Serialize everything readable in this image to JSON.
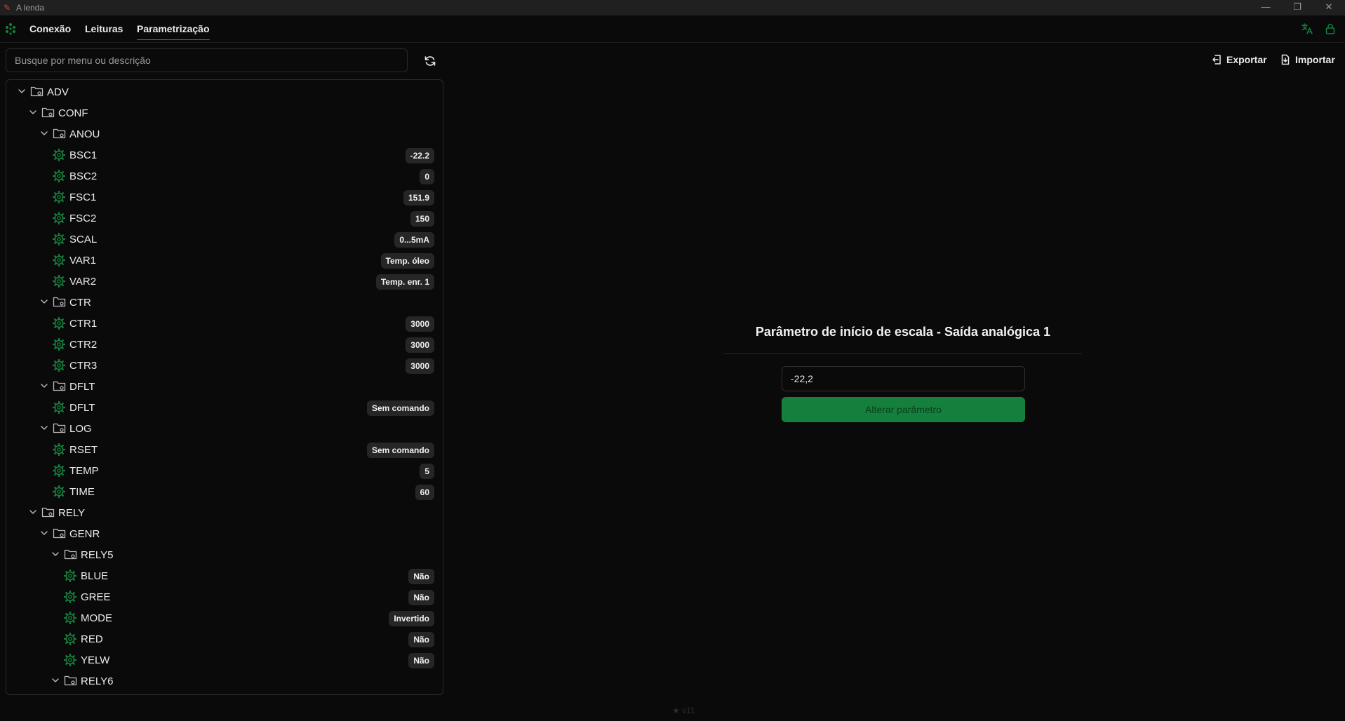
{
  "window": {
    "title": "A lenda"
  },
  "nav": {
    "items": [
      {
        "label": "Conexão",
        "active": false
      },
      {
        "label": "Leituras",
        "active": false
      },
      {
        "label": "Parametrização",
        "active": true
      }
    ]
  },
  "search": {
    "placeholder": "Busque por menu ou descrição",
    "value": ""
  },
  "actions": {
    "export_label": "Exportar",
    "import_label": "Importar"
  },
  "tree": [
    {
      "label": "ADV",
      "type": "folder",
      "depth": 0
    },
    {
      "label": "CONF",
      "type": "folder",
      "depth": 1
    },
    {
      "label": "ANOU",
      "type": "folder",
      "depth": 2
    },
    {
      "label": "BSC1",
      "type": "param",
      "depth": 3,
      "value": "-22.2"
    },
    {
      "label": "BSC2",
      "type": "param",
      "depth": 3,
      "value": "0"
    },
    {
      "label": "FSC1",
      "type": "param",
      "depth": 3,
      "value": "151.9"
    },
    {
      "label": "FSC2",
      "type": "param",
      "depth": 3,
      "value": "150"
    },
    {
      "label": "SCAL",
      "type": "param",
      "depth": 3,
      "value": "0...5mA"
    },
    {
      "label": "VAR1",
      "type": "param",
      "depth": 3,
      "value": "Temp. óleo"
    },
    {
      "label": "VAR2",
      "type": "param",
      "depth": 3,
      "value": "Temp. enr. 1"
    },
    {
      "label": "CTR",
      "type": "folder",
      "depth": 2
    },
    {
      "label": "CTR1",
      "type": "param",
      "depth": 3,
      "value": "3000"
    },
    {
      "label": "CTR2",
      "type": "param",
      "depth": 3,
      "value": "3000"
    },
    {
      "label": "CTR3",
      "type": "param",
      "depth": 3,
      "value": "3000"
    },
    {
      "label": "DFLT",
      "type": "folder",
      "depth": 2
    },
    {
      "label": "DFLT",
      "type": "param",
      "depth": 3,
      "value": "Sem comando"
    },
    {
      "label": "LOG",
      "type": "folder",
      "depth": 2
    },
    {
      "label": "RSET",
      "type": "param",
      "depth": 3,
      "value": "Sem comando"
    },
    {
      "label": "TEMP",
      "type": "param",
      "depth": 3,
      "value": "5"
    },
    {
      "label": "TIME",
      "type": "param",
      "depth": 3,
      "value": "60"
    },
    {
      "label": "RELY",
      "type": "folder",
      "depth": 1
    },
    {
      "label": "GENR",
      "type": "folder",
      "depth": 2
    },
    {
      "label": "RELY5",
      "type": "folder",
      "depth": 3
    },
    {
      "label": "BLUE",
      "type": "param",
      "depth": 4,
      "value": "Não"
    },
    {
      "label": "GREE",
      "type": "param",
      "depth": 4,
      "value": "Não"
    },
    {
      "label": "MODE",
      "type": "param",
      "depth": 4,
      "value": "Invertido"
    },
    {
      "label": "RED",
      "type": "param",
      "depth": 4,
      "value": "Não"
    },
    {
      "label": "YELW",
      "type": "param",
      "depth": 4,
      "value": "Não"
    },
    {
      "label": "RELY6",
      "type": "folder",
      "depth": 3
    }
  ],
  "detail": {
    "title": "Parâmetro de início de escala - Saída analógica 1",
    "value": "-22,2",
    "submit_label": "Alterar parâmetro"
  },
  "version": "v11",
  "colors": {
    "accent": "#15803d",
    "background": "#0a0a0a",
    "badge": "#262626"
  }
}
